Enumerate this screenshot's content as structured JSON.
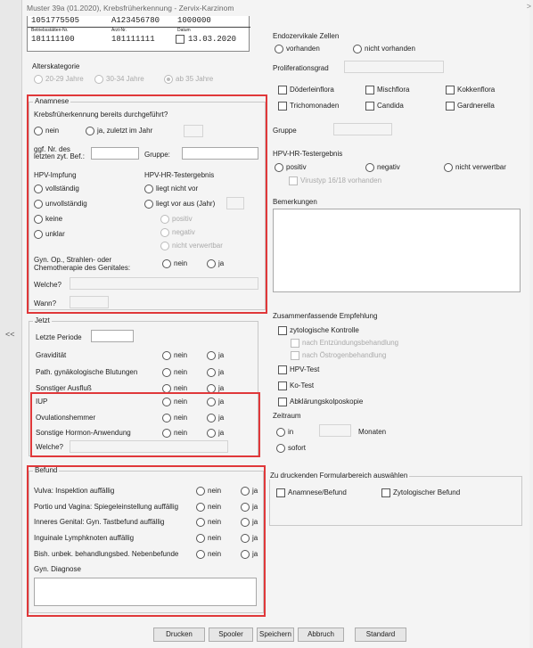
{
  "title": "Muster 39a (01.2020), Krebsfrüherkennung - Zervix-Karzinom",
  "header": {
    "row1": [
      "1051775505",
      "A123456780",
      "1000000"
    ],
    "lbl_betrieb": "Betriebsstätten-Nr.",
    "lbl_arzt": "Arzt-Nr.",
    "lbl_datum": "Datum",
    "row2": [
      "181111100",
      "181111111",
      "13.03.2020"
    ]
  },
  "alterskategorie": {
    "label": "Alterskategorie",
    "options": [
      "20-29 Jahre",
      "30-34 Jahre",
      "ab 35 Jahre"
    ]
  },
  "anamnese": {
    "legend": "Anamnese",
    "q1": "Krebsfrüherkennung bereits durchgeführt?",
    "nein": "nein",
    "ja_zuletzt": "ja, zuletzt im Jahr",
    "ggf_nr": "ggf. Nr. des letzten zyt. Bef.:",
    "gruppe": "Gruppe:",
    "hpv_impfung": "HPV-Impfung",
    "impf_opts": [
      "vollständig",
      "unvollständig",
      "keine",
      "unklar"
    ],
    "hpv_ergebnis": "HPV-HR-Testergebnis",
    "liegt_nicht_vor": "liegt nicht vor",
    "liegt_vor_aus": "liegt vor aus (Jahr)",
    "sub_opts": [
      "positiv",
      "negativ",
      "nicht verwertbar"
    ],
    "gyn_op": "Gyn. Op., Strahlen- oder Chemotherapie des Genitales:",
    "ja": "ja",
    "welche": "Welche?",
    "wann": "Wann?"
  },
  "jetzt": {
    "legend": "Jetzt",
    "letzte_periode": "Letzte Periode",
    "rows": [
      "Gravidität",
      "Path. gynäkologische Blutungen",
      "Sonstiger Ausfluß"
    ],
    "rows2": [
      "IUP",
      "Ovulationshemmer",
      "Sonstige Hormon-Anwendung"
    ],
    "nein": "nein",
    "ja": "ja",
    "welche": "Welche?"
  },
  "befund": {
    "legend": "Befund",
    "rows": [
      "Vulva: Inspektion auffällig",
      "Portio und Vagina: Spiegeleinstellung auffällig",
      "Inneres Genital: Gyn. Tastbefund auffällig",
      "Inguinale Lymphknoten auffällig",
      "Bish. unbek. behandlungsbed. Nebenbefunde"
    ],
    "nein": "nein",
    "ja": "ja",
    "diagnose": "Gyn. Diagnose"
  },
  "right": {
    "endozervikale": "Endozervikale Zellen",
    "vorhanden": "vorhanden",
    "nicht_vorhanden": "nicht vorhanden",
    "proliferationsgrad": "Proliferationsgrad",
    "flora": [
      "Döderleinflora",
      "Mischflora",
      "Kokkenflora",
      "Trichomonaden",
      "Candida",
      "Gardnerella"
    ],
    "gruppe": "Gruppe",
    "hpv_ergebnis": "HPV-HR-Testergebnis",
    "positiv": "positiv",
    "negativ": "negativ",
    "nicht_verwertbar": "nicht verwertbar",
    "virustyp": "Virustyp 16/18 vorhanden",
    "bemerkungen": "Bemerkungen",
    "empfehlung": "Zusammenfassende Empfehlung",
    "zyt_kontrolle": "zytologische Kontrolle",
    "nach_entz": "nach Entzündungsbehandlung",
    "nach_oestro": "nach Östrogenbehandlung",
    "hpv_test": "HPV-Test",
    "ko_test": "Ko-Test",
    "abklaerung": "Abklärungskolposkopie",
    "zeitraum": "Zeitraum",
    "in": "in",
    "monaten": "Monaten",
    "sofort": "sofort",
    "druck_legend": "Zu druckenden Formularbereich auswählen",
    "druck_opts": [
      "Anamnese/Befund",
      "Zytologischer Befund"
    ]
  },
  "buttons": [
    "Drucken",
    "Spooler",
    "Speichern",
    "Abbruch",
    "Standard"
  ],
  "collapse": "<<",
  "close_chev": ">"
}
